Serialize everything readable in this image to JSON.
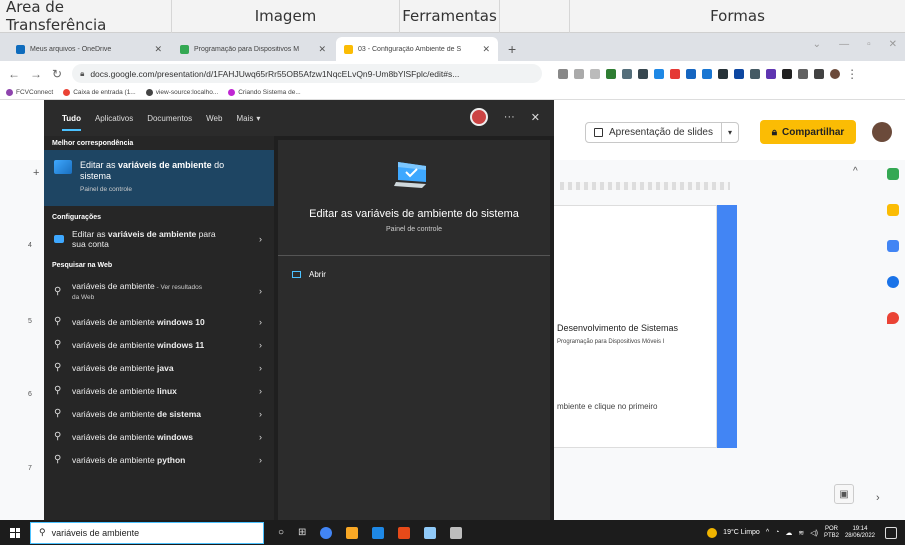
{
  "ribbon": {
    "tabs": [
      "Área de Transferência",
      "Imagem",
      "Ferramentas",
      "",
      "Formas"
    ]
  },
  "browser": {
    "tabs": [
      {
        "title": "Meus arquivos - OneDrive",
        "favicon_color": "#0f6cbd"
      },
      {
        "title": "Programação para Dispositivos M",
        "favicon_color": "#34a853"
      },
      {
        "title": "03 - Configuração Ambiente de S",
        "favicon_color": "#fbbc04",
        "active": true
      }
    ],
    "new_tab": "+",
    "url": "docs.google.com/presentation/d/1FAHJUwq65rRr55OB5Afzw1NqcELvQn9-Um8bYlSFplc/edit#s...",
    "bookmarks": [
      {
        "label": "FCVConnect",
        "color": "#8e44ad"
      },
      {
        "label": "Caixa de entrada (1...",
        "color": "#ea4335"
      },
      {
        "label": "view-source:localho...",
        "color": "#444"
      },
      {
        "label": "Criando Sistema de...",
        "color": "#c026d3"
      }
    ]
  },
  "slides": {
    "present_label": "Apresentação de slides",
    "share_label": "Compartilhar",
    "slide_title": "Desenvolvimento de Sistemas",
    "slide_subtitle": "Programação para Dispositivos Móveis I",
    "slide_body": "mbiente e clique no primeiro",
    "thumb_numbers": [
      "4",
      "5",
      "6",
      "7"
    ]
  },
  "search_panel": {
    "filters": [
      "Tudo",
      "Aplicativos",
      "Documentos",
      "Web",
      "Mais"
    ],
    "best_match_header": "Melhor correspondência",
    "best_match": {
      "line1_prefix": "Editar as ",
      "line1_bold": "variáveis de ambiente",
      "line1_suffix": " do",
      "line2": "sistema",
      "sub": "Painel de controle"
    },
    "config_header": "Configurações",
    "config_item": {
      "prefix": "Editar as ",
      "bold": "variáveis de ambiente",
      "suffix": " para",
      "line2": "sua conta"
    },
    "web_header": "Pesquisar na Web",
    "web_first": {
      "text": "variáveis de ambiente",
      "suffix": " - Ver resultados",
      "line2": "da Web"
    },
    "web_items": [
      {
        "prefix": "variáveis de ambiente ",
        "bold": "windows 10"
      },
      {
        "prefix": "variáveis de ambiente ",
        "bold": "windows 11"
      },
      {
        "prefix": "variáveis de ambiente ",
        "bold": "java"
      },
      {
        "prefix": "variáveis de ambiente ",
        "bold": "linux"
      },
      {
        "prefix": "variáveis de ambiente ",
        "bold": "de sistema"
      },
      {
        "prefix": "variáveis de ambiente ",
        "bold": "windows"
      },
      {
        "prefix": "variáveis de ambiente ",
        "bold": "python"
      }
    ],
    "right_title": "Editar as variáveis de ambiente do sistema",
    "right_sub": "Painel de controle",
    "open_label": "Abrir"
  },
  "taskbar": {
    "search_value": "variáveis de ambiente",
    "weather": "19°C Limpo",
    "lang1": "POR",
    "lang2": "PTB2",
    "time": "19:14",
    "date": "28/06/2022"
  }
}
